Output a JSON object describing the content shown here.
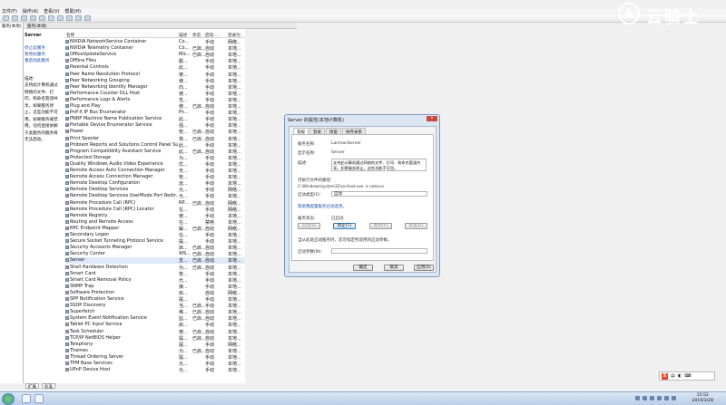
{
  "menu": [
    "文件(F)",
    "操作(A)",
    "查看(V)",
    "帮助(H)"
  ],
  "leftnav": {
    "label": "服务(本地)"
  },
  "tab_header": {
    "label": "服务(本地)"
  },
  "service_pane": {
    "title": "Server",
    "links": [
      "停止此服务",
      "暂停此服务",
      "重启动此服务"
    ],
    "desc_label": "描述:",
    "desc_lines": [
      "支持此计算机通过",
      "网络的文件、打",
      "印、和命名管道共",
      "享。如果服务停",
      "止，这些功能不可",
      "用。如果服务被禁",
      "用，任何直接依赖",
      "于此服务的服务将",
      "无法启动。"
    ]
  },
  "list": {
    "headers": [
      "名称",
      "描述",
      "状态",
      "启动...",
      "登录为"
    ],
    "rows": [
      [
        "NVIDIA NetworkService Container",
        "Co...",
        "",
        "手动",
        "网络..."
      ],
      [
        "NVIDIA Telemetry Container",
        "Co...",
        "已启...",
        "自动",
        "本地..."
      ],
      [
        "OfficeUpdateService",
        "Mic...",
        "已启...",
        "自动",
        "本地..."
      ],
      [
        "Offline Files",
        "脱...",
        "",
        "手动",
        "本地..."
      ],
      [
        "Parental Controls",
        "此...",
        "",
        "手动",
        "本地..."
      ],
      [
        "Peer Name Resolution Protocol",
        "使...",
        "",
        "手动",
        "本地..."
      ],
      [
        "Peer Networking Grouping",
        "使...",
        "",
        "手动",
        "本地..."
      ],
      [
        "Peer Networking Identity Manager",
        "向...",
        "",
        "手动",
        "本地..."
      ],
      [
        "Performance Counter DLL Host",
        "使...",
        "",
        "手动",
        "本地..."
      ],
      [
        "Performance Logs & Alerts",
        "性...",
        "",
        "手动",
        "本地..."
      ],
      [
        "Plug and Play",
        "使...",
        "已启...",
        "自动",
        "本地..."
      ],
      [
        "PnP-X IP Bus Enumerator",
        "Pn...",
        "",
        "手动",
        "本地..."
      ],
      [
        "PNRP Machine Name Publication Service",
        "此...",
        "",
        "手动",
        "本地..."
      ],
      [
        "Portable Device Enumerator Service",
        "强...",
        "",
        "手动",
        "本地..."
      ],
      [
        "Power",
        "管...",
        "已启...",
        "自动",
        "本地..."
      ],
      [
        "Print Spooler",
        "将...",
        "已启...",
        "自动",
        "本地..."
      ],
      [
        "Problem Reports and Solutions Control Panel Su...",
        "此...",
        "",
        "手动",
        "本地..."
      ],
      [
        "Program Compatibility Assistant Service",
        "此...",
        "已启...",
        "自动",
        "本地..."
      ],
      [
        "Protected Storage",
        "为...",
        "",
        "手动",
        "本地..."
      ],
      [
        "Quality Windows Audio Video Experience",
        "优...",
        "",
        "手动",
        "本地..."
      ],
      [
        "Remote Access Auto Connection Manager",
        "无...",
        "",
        "手动",
        "本地..."
      ],
      [
        "Remote Access Connection Manager",
        "管...",
        "",
        "手动",
        "本地..."
      ],
      [
        "Remote Desktop Configuration",
        "远...",
        "",
        "手动",
        "本地..."
      ],
      [
        "Remote Desktop Services",
        "允...",
        "",
        "手动",
        "网络..."
      ],
      [
        "Remote Desktop Services UserMode Port Redir...",
        "允...",
        "",
        "手动",
        "本地..."
      ],
      [
        "Remote Procedure Call (RPC)",
        "RP...",
        "已启...",
        "自动",
        "网络..."
      ],
      [
        "Remote Procedure Call (RPC) Locator",
        "在...",
        "",
        "手动",
        "网络..."
      ],
      [
        "Remote Registry",
        "使...",
        "",
        "手动",
        "本地..."
      ],
      [
        "Routing and Remote Access",
        "在...",
        "",
        "禁用",
        "本地..."
      ],
      [
        "RPC Endpoint Mapper",
        "解...",
        "已启...",
        "自动",
        "网络..."
      ],
      [
        "Secondary Logon",
        "在...",
        "",
        "手动",
        "本地..."
      ],
      [
        "Secure Socket Tunneling Protocol Service",
        "提...",
        "",
        "手动",
        "本地..."
      ],
      [
        "Security Accounts Manager",
        "启...",
        "已启...",
        "自动",
        "本地..."
      ],
      [
        "Security Center",
        "WS...",
        "已启...",
        "自动",
        "本地..."
      ],
      [
        "Server",
        "支...",
        "已启...",
        "自动",
        "本地..."
      ],
      [
        "Shell Hardware Detection",
        "为...",
        "已启...",
        "自动",
        "本地..."
      ],
      [
        "Smart Card",
        "管...",
        "",
        "手动",
        "本地..."
      ],
      [
        "Smart Card Removal Policy",
        "允...",
        "",
        "手动",
        "本地..."
      ],
      [
        "SNMP Trap",
        "接...",
        "",
        "手动",
        "本地..."
      ],
      [
        "Software Protection",
        "启...",
        "",
        "自动",
        "网络..."
      ],
      [
        "SPP Notification Service",
        "提...",
        "",
        "手动",
        "本地..."
      ],
      [
        "SSDP Discovery",
        "当...",
        "已启...",
        "手动",
        "本地..."
      ],
      [
        "Superfetch",
        "维...",
        "已启...",
        "自动",
        "本地..."
      ],
      [
        "System Event Notification Service",
        "监...",
        "已启...",
        "自动",
        "本地..."
      ],
      [
        "Tablet PC Input Service",
        "启...",
        "",
        "手动",
        "本地..."
      ],
      [
        "Task Scheduler",
        "使...",
        "已启...",
        "自动",
        "本地..."
      ],
      [
        "TCP/IP NetBIOS Helper",
        "提...",
        "已启...",
        "自动",
        "本地..."
      ],
      [
        "Telephony",
        "提...",
        "",
        "手动",
        "网络..."
      ],
      [
        "Themes",
        "为...",
        "已启...",
        "自动",
        "本地..."
      ],
      [
        "Thread Ordering Server",
        "提...",
        "",
        "手动",
        "本地..."
      ],
      [
        "TPM Base Services",
        "允...",
        "",
        "手动",
        "本地..."
      ],
      [
        "UPnP Device Host",
        "允...",
        "",
        "手动",
        "本地..."
      ]
    ],
    "selected_index": 34
  },
  "bottom_tabs": [
    "扩展",
    "标准"
  ],
  "dialog": {
    "title": "Server 的属性(本地计算机)",
    "close": "x",
    "tabs": [
      "常规",
      "登录",
      "恢复",
      "依存关系"
    ],
    "service_name_label": "服务名称:",
    "service_name": "LanmanServer",
    "display_name_label": "显示名称:",
    "display_name": "Server",
    "desc_label": "描述:",
    "desc_text": "支持此计算机通过网络的文件、打印、和命名管道共享。如果服务停止，这些功能不可用。",
    "path_label": "可执行文件的路径:",
    "path": "C:\\Windows\\system32\\svchost.exe -k netsvcs",
    "startup_label": "启动类型(E):",
    "startup_value": "自动",
    "help_link": "帮助我配置服务启动选项。",
    "status_label": "服务状态:",
    "status_value": "已启动",
    "btn_start": "启动(S)",
    "btn_stop": "停止(T)",
    "btn_pause": "暂停(P)",
    "btn_resume": "恢复(R)",
    "hint": "当从此处启动服务时，您可指定所适用的启动参数。",
    "param_label": "启动参数(M):",
    "ok": "确定",
    "cancel": "取消",
    "apply": "应用(A)"
  },
  "logo": {
    "text": "云骑士"
  },
  "ime": {
    "badge": "S",
    "glyph": "中"
  },
  "clock": {
    "time": "15:52",
    "date": "2019/3/28"
  }
}
